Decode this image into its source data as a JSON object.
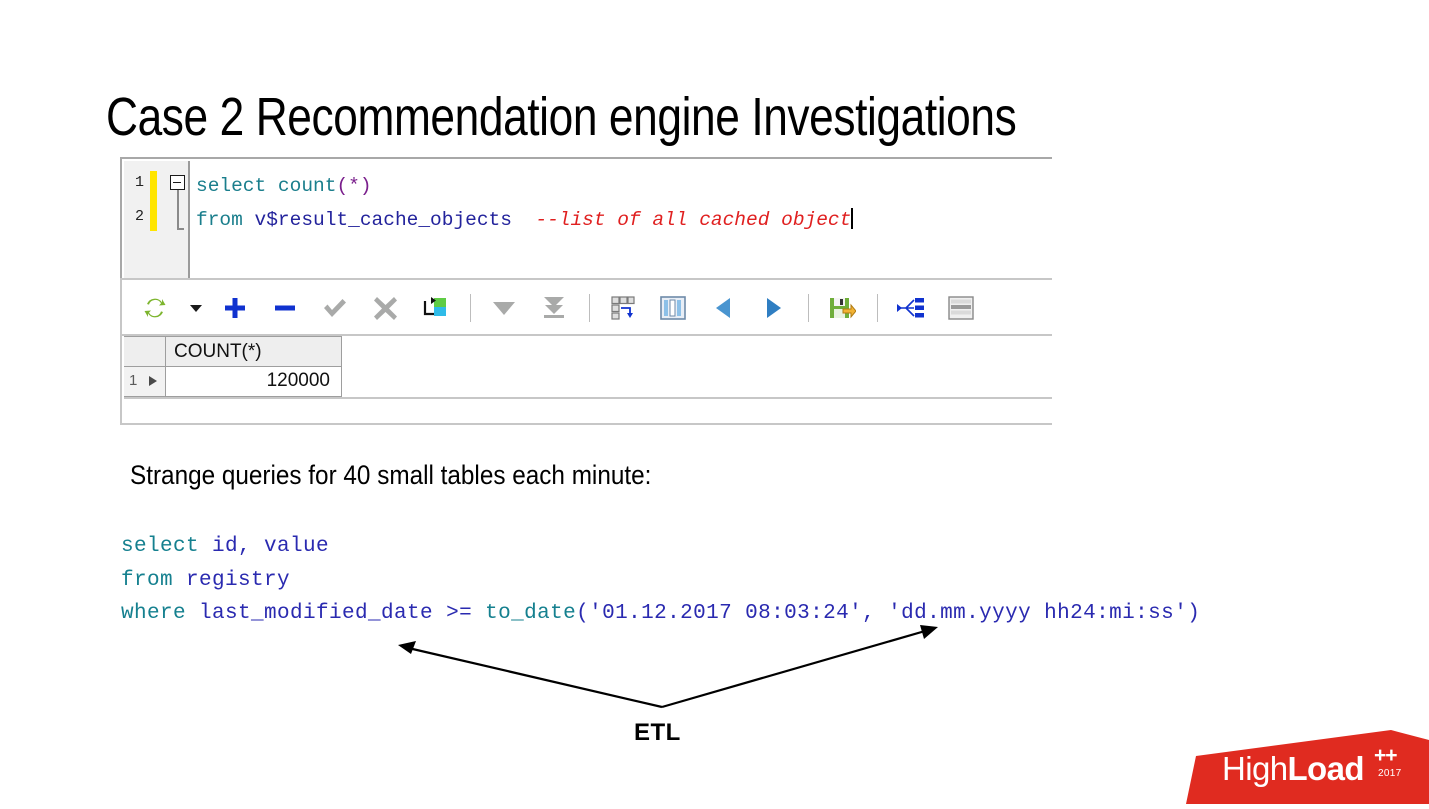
{
  "slide": {
    "title": "Case 2 Recommendation engine Investigations",
    "caption": "Strange queries for 40 small tables each minute:"
  },
  "sql_editor": {
    "gutter": {
      "line_numbers": [
        "1",
        "2"
      ],
      "fold_marker": "collapse-box"
    },
    "code": {
      "line1": {
        "keyword": "select count",
        "punct": "(*)"
      },
      "line2": {
        "keyword": "from ",
        "identifier": "v$result_cache_objects",
        "comment": "--list of all cached object"
      }
    },
    "toolbar": {
      "items": [
        {
          "name": "refresh-icon",
          "label": "Refresh"
        },
        {
          "name": "chevron-down-icon",
          "label": "Refresh options"
        },
        {
          "name": "add-row-icon",
          "label": "Insert row"
        },
        {
          "name": "delete-row-icon",
          "label": "Delete row"
        },
        {
          "name": "commit-icon",
          "label": "Commit"
        },
        {
          "name": "rollback-icon",
          "label": "Rollback"
        },
        {
          "name": "export-grid-icon",
          "label": "Export data"
        },
        {
          "name": "fetch-next-icon",
          "label": "Fetch next page"
        },
        {
          "name": "fetch-all-icon",
          "label": "Fetch all rows"
        },
        {
          "name": "grid-layout-icon",
          "label": "Single record view"
        },
        {
          "name": "column-chart-icon",
          "label": "Column info"
        },
        {
          "name": "prev-record-icon",
          "label": "Previous record"
        },
        {
          "name": "next-record-icon",
          "label": "Next record"
        },
        {
          "name": "save-grid-icon",
          "label": "Save grid"
        },
        {
          "name": "explain-plan-icon",
          "label": "Explain plan"
        },
        {
          "name": "script-output-icon",
          "label": "Script output"
        }
      ]
    },
    "result_grid": {
      "column_header": "COUNT(*)",
      "rows": [
        {
          "row_number": "1",
          "value": "120000"
        }
      ]
    }
  },
  "bottom_query": {
    "line1_kw": "select",
    "line1_ident": " id, value",
    "line2_kw": "from",
    "line2_ident": " registry",
    "line3_kw": "where",
    "line3_ident": " last_modified_date ",
    "line3_op": ">= ",
    "line3_fn": "to_date",
    "line3_args": "('01.12.2017 08:03:24', 'dd.mm.yyyy hh24:mi:ss')"
  },
  "annotation": {
    "etl_label": "ETL"
  },
  "logo": {
    "part1": "High",
    "part2": "Load",
    "plus": "++",
    "year": "2017",
    "color": "#e02b20"
  }
}
